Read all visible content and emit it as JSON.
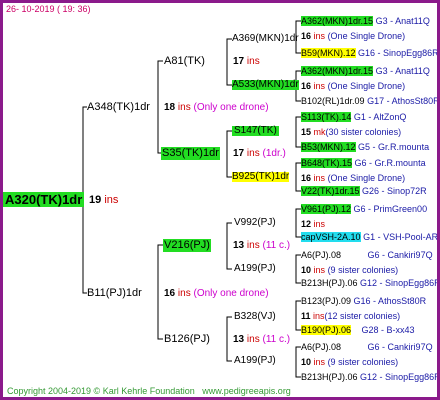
{
  "header": "26- 10-2019 ( 19: 36)",
  "root": {
    "name": "A320(TK)1dr",
    "num": "19",
    "ins": "ins"
  },
  "g1": [
    {
      "name": "A348(TK)1dr",
      "num": "18",
      "ins": "ins",
      "note": "(Only one drone)"
    },
    {
      "name": "B11(PJ)1dr",
      "num": "16",
      "ins": "ins",
      "note": "(Only one drone)"
    }
  ],
  "g2": [
    {
      "name": "A81(TK)"
    },
    {
      "name": "S35(TK)1dr",
      "num": "17",
      "ins": "ins",
      "note": "(1dr.)"
    },
    {
      "name": "V216(PJ)",
      "num": "13",
      "ins": "ins",
      "note": "(11 c.)"
    },
    {
      "name": "B126(PJ)",
      "num": "13",
      "ins": "ins",
      "note": "(11 c.)"
    }
  ],
  "g3": [
    {
      "name": "A369(MKN)1dr",
      "num": "17",
      "ins": "ins"
    },
    {
      "name": "A533(MKN)1dr"
    },
    {
      "name": "S147(TK)",
      "num": "15",
      "ins": "mk",
      "note": "(30 sister colonies)"
    },
    {
      "name": "B925(TK)1dr"
    },
    {
      "name": "V992(PJ)",
      "num": "12",
      "ins": "ins"
    },
    {
      "name": "A199(PJ)"
    },
    {
      "name": "B328(VJ)",
      "num": "11",
      "ins": "ins",
      "note": "(12 sister colonies)"
    },
    {
      "name": "A199(PJ)"
    }
  ],
  "g4": [
    {
      "name": "A362(MKN)1dr.15",
      "info": "G3 - Anat11Q"
    },
    {
      "num": "16",
      "ins": "ins",
      "note": "(One Single Drone)"
    },
    {
      "name": "B59(MKN).12",
      "info": "G16 - SinopEgg86R"
    },
    {
      "name": "A362(MKN)1dr.15",
      "info": "G3 - Anat11Q"
    },
    {
      "num": "16",
      "ins": "ins",
      "note": "(One Single Drone)"
    },
    {
      "name": "B102(RL)1dr.09",
      "info": "G17 - AthosSt80R"
    },
    {
      "name": "S113(TK).14",
      "info": "G1 - AltZonQ"
    },
    {
      "name": "B53(MKN).12",
      "info": "G5 - Gr.R.mounta"
    },
    {
      "name": "B648(TK).15",
      "info": "G6 - Gr.R.mounta"
    },
    {
      "num": "16",
      "ins": "ins",
      "note": "(One Single Drone)"
    },
    {
      "name": "V22(TK)1dr.15",
      "info": "G26 - Sinop72R"
    },
    {
      "name": "V961(PJ).12",
      "info": "G6 - PrimGreen00"
    },
    {
      "name": "capVSH-2A.10",
      "info": "G1 - VSH-Pool-AR"
    },
    {
      "name": "A6(PJ).08",
      "info": "G6 - Cankiri97Q"
    },
    {
      "num": "10",
      "ins": "ins",
      "note": "(9 sister colonies)"
    },
    {
      "name": "B213H(PJ).06",
      "info": "G12 - SinopEgg86R"
    },
    {
      "name": "B123(PJ).09",
      "info": "G16 - AthosSt80R"
    },
    {
      "name": "B190(PJ).06",
      "info": "G28 - B-xx43"
    },
    {
      "name": "A6(PJ).08",
      "info": "G6 - Cankiri97Q"
    },
    {
      "num": "10",
      "ins": "ins",
      "note": "(9 sister colonies)"
    },
    {
      "name": "B213H(PJ).06",
      "info": "G12 - SinopEgg86R"
    }
  ],
  "footer": {
    "copyright": "Copyright 2004-2019 © Karl Kehrle Foundation",
    "url": "www.pedigreeapis.org"
  },
  "colors": {
    "border": "#8b1a8b",
    "green": "#22dd22",
    "yellow": "#ffff00",
    "cyan": "#22ddee",
    "ins": "#cc0000",
    "info": "#1a1aa6"
  }
}
